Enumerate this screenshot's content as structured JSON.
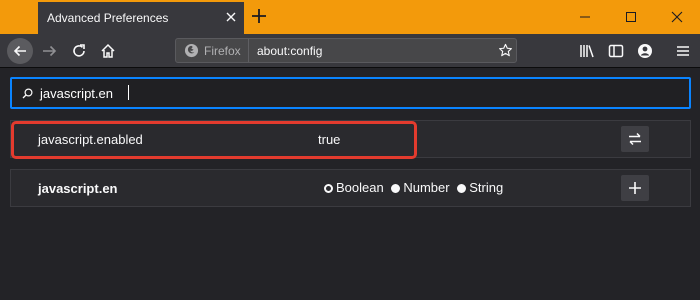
{
  "window": {
    "tab_title": "Advanced Preferences"
  },
  "toolbar": {
    "identity_label": "Firefox",
    "url": "about:config"
  },
  "search": {
    "value": "javascript.en"
  },
  "prefs": [
    {
      "name": "javascript.enabled",
      "value": "true",
      "action_icon": "toggle-arrows-icon"
    }
  ],
  "new_pref": {
    "name": "javascript.en",
    "types": [
      {
        "label": "Boolean",
        "selected": true
      },
      {
        "label": "Number",
        "selected": false
      },
      {
        "label": "String",
        "selected": false
      }
    ],
    "action_icon": "add-icon"
  },
  "colors": {
    "titlebar": "#f39a0b",
    "accent": "#0a84ff",
    "highlight": "#e33b2e"
  }
}
